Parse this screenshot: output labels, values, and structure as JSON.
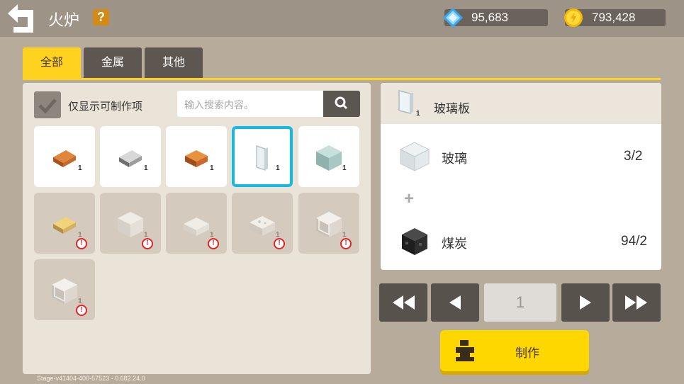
{
  "header": {
    "title": "火炉",
    "help_label": "?",
    "diamond_value": "95,683",
    "coin_value": "793,428"
  },
  "tabs": [
    {
      "label": "全部",
      "active": true
    },
    {
      "label": "金属",
      "active": false
    },
    {
      "label": "其他",
      "active": false
    }
  ],
  "filter": {
    "label": "仅显示可制作项",
    "checked": true,
    "search_placeholder": "输入搜索内容。"
  },
  "items": [
    {
      "icon": "copper-ingot-icon",
      "count": "1",
      "available": true,
      "selected": false
    },
    {
      "icon": "iron-ingot-icon",
      "count": "1",
      "available": true,
      "selected": false
    },
    {
      "icon": "brick-icon",
      "count": "1",
      "available": true,
      "selected": false
    },
    {
      "icon": "glass-pane-icon",
      "count": "1",
      "available": true,
      "selected": true
    },
    {
      "icon": "glass-block-icon",
      "count": "1",
      "available": true,
      "selected": false
    },
    {
      "icon": "gold-ingot-icon",
      "count": "1",
      "available": false,
      "selected": false
    },
    {
      "icon": "quartz-block-icon",
      "count": "1",
      "available": false,
      "selected": false
    },
    {
      "icon": "quartz-slab-icon",
      "count": "1",
      "available": false,
      "selected": false
    },
    {
      "icon": "stone-slab-icon",
      "count": "1",
      "available": false,
      "selected": false
    },
    {
      "icon": "smooth-stone-icon",
      "count": "1",
      "available": false,
      "selected": false
    },
    {
      "icon": "white-block-icon",
      "count": "1",
      "available": false,
      "selected": false
    }
  ],
  "version": "Stage-v41404-400-57523 - 0.682.24.0",
  "recipe": {
    "title": "玻璃板",
    "title_count": "1",
    "ingredients": [
      {
        "name": "玻璃",
        "qty": "3/2",
        "icon": "glass-block-icon"
      },
      {
        "name": "煤炭",
        "qty": "94/2",
        "icon": "coal-block-icon"
      }
    ],
    "plus": "+"
  },
  "pagination": {
    "page": "1"
  },
  "craft_label": "制作",
  "colors": {
    "accent": "#ffd21f",
    "selected_border": "#18b8e4",
    "warning": "#e02525"
  }
}
